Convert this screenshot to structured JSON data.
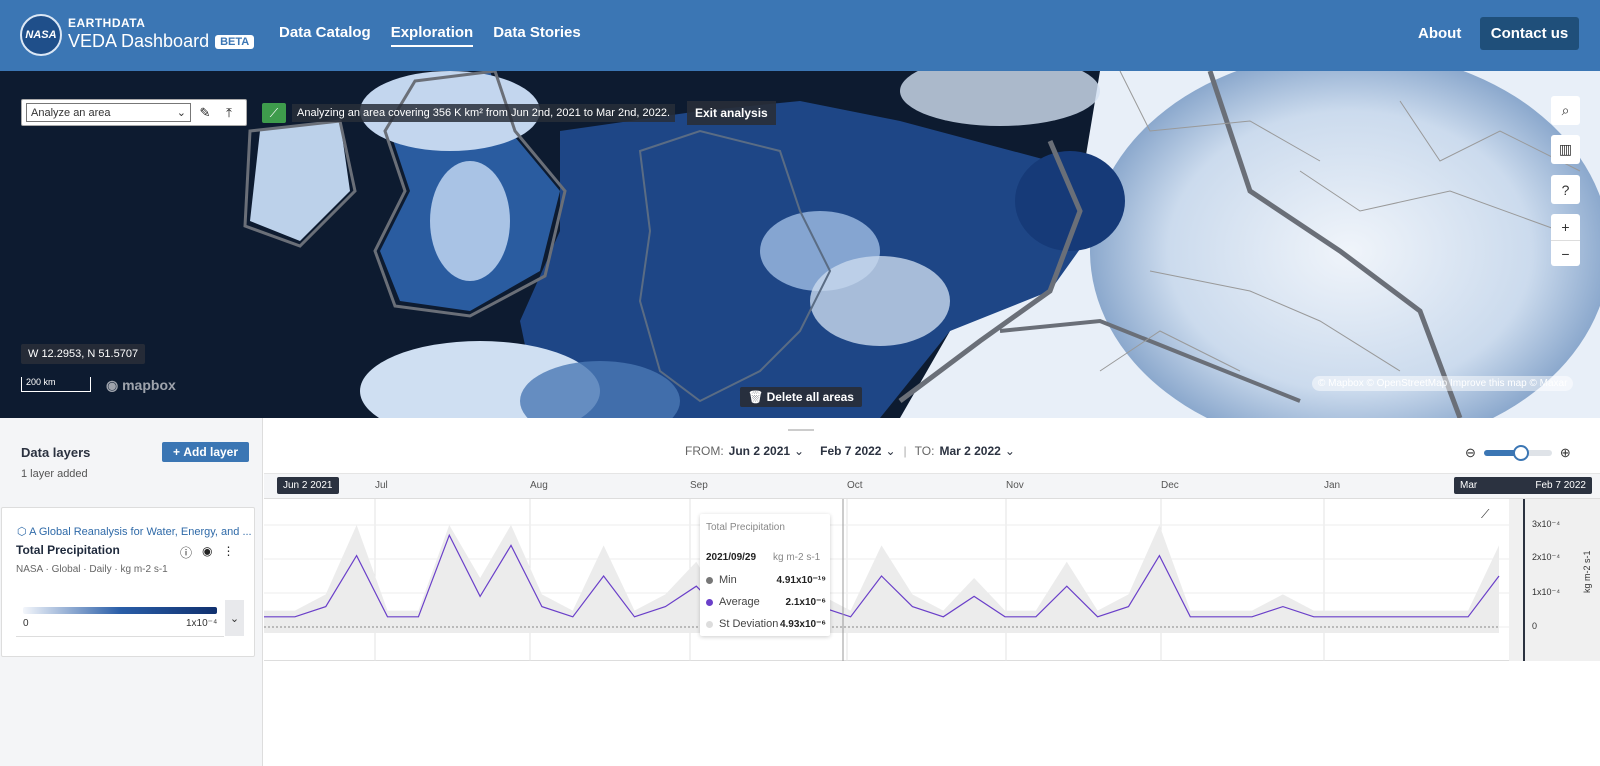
{
  "header": {
    "logo_text": "NASA",
    "brand_top": "EARTHDATA",
    "brand_main": "VEDA Dashboard",
    "beta": "BETA",
    "nav": [
      "Data Catalog",
      "Exploration",
      "Data Stories"
    ],
    "active_nav": "Exploration",
    "about": "About",
    "contact": "Contact us"
  },
  "map": {
    "analyze_select": "Analyze an area",
    "analysis_message": "Analyzing an area covering 356 K km² from Jun 2nd, 2021 to Mar 2nd, 2022.",
    "exit_analysis": "Exit analysis",
    "coords": "W 12.2953, N 51.5707",
    "scale": "200 km",
    "mapbox": "mapbox",
    "delete_all_areas": "Delete all areas",
    "attribution": "© Mapbox © OpenStreetMap Improve this map © Maxar",
    "controls": [
      "search-icon",
      "map-icon",
      "help-icon",
      "plus-icon",
      "minus-icon"
    ]
  },
  "layers": {
    "title": "Data layers",
    "count": "1 layer added",
    "add_layer": "Add layer",
    "card": {
      "source": "A Global Reanalysis for Water, Energy, and ...",
      "name": "Total Precipitation",
      "meta": "NASA · Global · Daily · kg m-2 s-1",
      "legend_min": "0",
      "legend_max": "1x10⁻⁴"
    }
  },
  "timeline": {
    "from_label": "FROM:",
    "from_value": "Jun 2 2021",
    "selected_value": "Feb 7 2022",
    "to_label": "TO:",
    "to_value": "Mar 2 2022",
    "months": [
      "Jul",
      "Aug",
      "Sep",
      "Oct",
      "Nov",
      "Dec",
      "Jan"
    ],
    "badge_start": "Jun 2 2021",
    "badge_end_left": "Mar",
    "badge_end_right": "Feb 7 2022",
    "zoom_level": 0.55
  },
  "chart": {
    "y_ticks": [
      "3x10⁻⁴",
      "2x10⁻⁴",
      "1x10⁻⁴",
      "0"
    ],
    "y_label": "kg m-2 s-1",
    "tooltip": {
      "title": "Total Precipitation",
      "date": "2021/09/29",
      "unit": "kg m-2 s-1",
      "rows": [
        {
          "label": "Min",
          "value": "4.91x10⁻¹⁹",
          "color": "#777777"
        },
        {
          "label": "Average",
          "value": "2.1x10⁻⁶",
          "color": "#6a3fc9"
        },
        {
          "label": "St Deviation",
          "value": "4.93x10⁻⁶",
          "color": "#dddddd"
        }
      ]
    }
  },
  "chart_data": {
    "type": "line",
    "title": "Total Precipitation",
    "ylabel": "kg m-2 s-1",
    "ylim": [
      0,
      0.0003
    ],
    "series": [
      {
        "name": "Average",
        "values": [
          1e-05,
          1e-05,
          2e-05,
          7e-05,
          1e-05,
          1e-05,
          9e-05,
          3e-05,
          8e-05,
          2e-05,
          1e-05,
          5e-05,
          1e-05,
          2e-05,
          4e-05,
          1e-05,
          0.0001,
          4e-05,
          2e-05,
          1e-05,
          5e-05,
          2e-05,
          1e-05,
          3e-05,
          1e-05,
          1e-05,
          4e-05,
          1e-05,
          2e-05,
          7e-05,
          1e-05,
          1e-05,
          1e-05,
          2e-05,
          1e-05,
          1e-05,
          1e-05,
          1e-05,
          1e-05,
          1e-05,
          5e-05
        ]
      }
    ]
  }
}
